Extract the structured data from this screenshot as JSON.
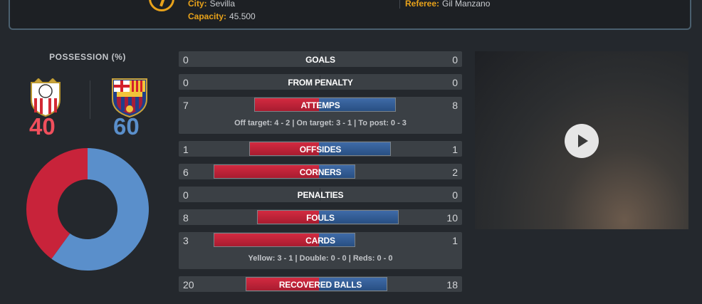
{
  "match_info": {
    "city_label": "City:",
    "city_value": "Sevilla",
    "capacity_label": "Capacity:",
    "capacity_value": "45.500",
    "referee_label": "Referee:",
    "referee_value": "Gil Manzano"
  },
  "possession": {
    "title": "POSSESSION (%)",
    "home_value": "40",
    "away_value": "60",
    "home_color": "#f04f5c",
    "away_color": "#5a8fcb",
    "home_fraction": 0.4,
    "away_fraction": 0.6
  },
  "stats": [
    {
      "label": "GOALS",
      "home": "0",
      "away": "0"
    },
    {
      "label": "FROM PENALTY",
      "home": "0",
      "away": "0"
    },
    {
      "label": "ATTEMPS",
      "home": "7",
      "away": "8",
      "detail": "Off target: 4 - 2 | On target: 3 - 1 | To post: 0 - 3"
    },
    {
      "label": "OFFSIDES",
      "home": "1",
      "away": "1"
    },
    {
      "label": "CORNERS",
      "home": "6",
      "away": "2"
    },
    {
      "label": "PENALTIES",
      "home": "0",
      "away": "0"
    },
    {
      "label": "FOULS",
      "home": "8",
      "away": "10"
    },
    {
      "label": "CARDS",
      "home": "3",
      "away": "1",
      "detail": "Yellow: 3 - 1 | Double: 0 - 0 | Reds: 0 - 0"
    },
    {
      "label": "RECOVERED BALLS",
      "home": "20",
      "away": "18"
    }
  ],
  "colors": {
    "home": "#c8233a",
    "away": "#34609a",
    "accent": "#e8a21a"
  },
  "video": {
    "icon": "play-icon"
  }
}
